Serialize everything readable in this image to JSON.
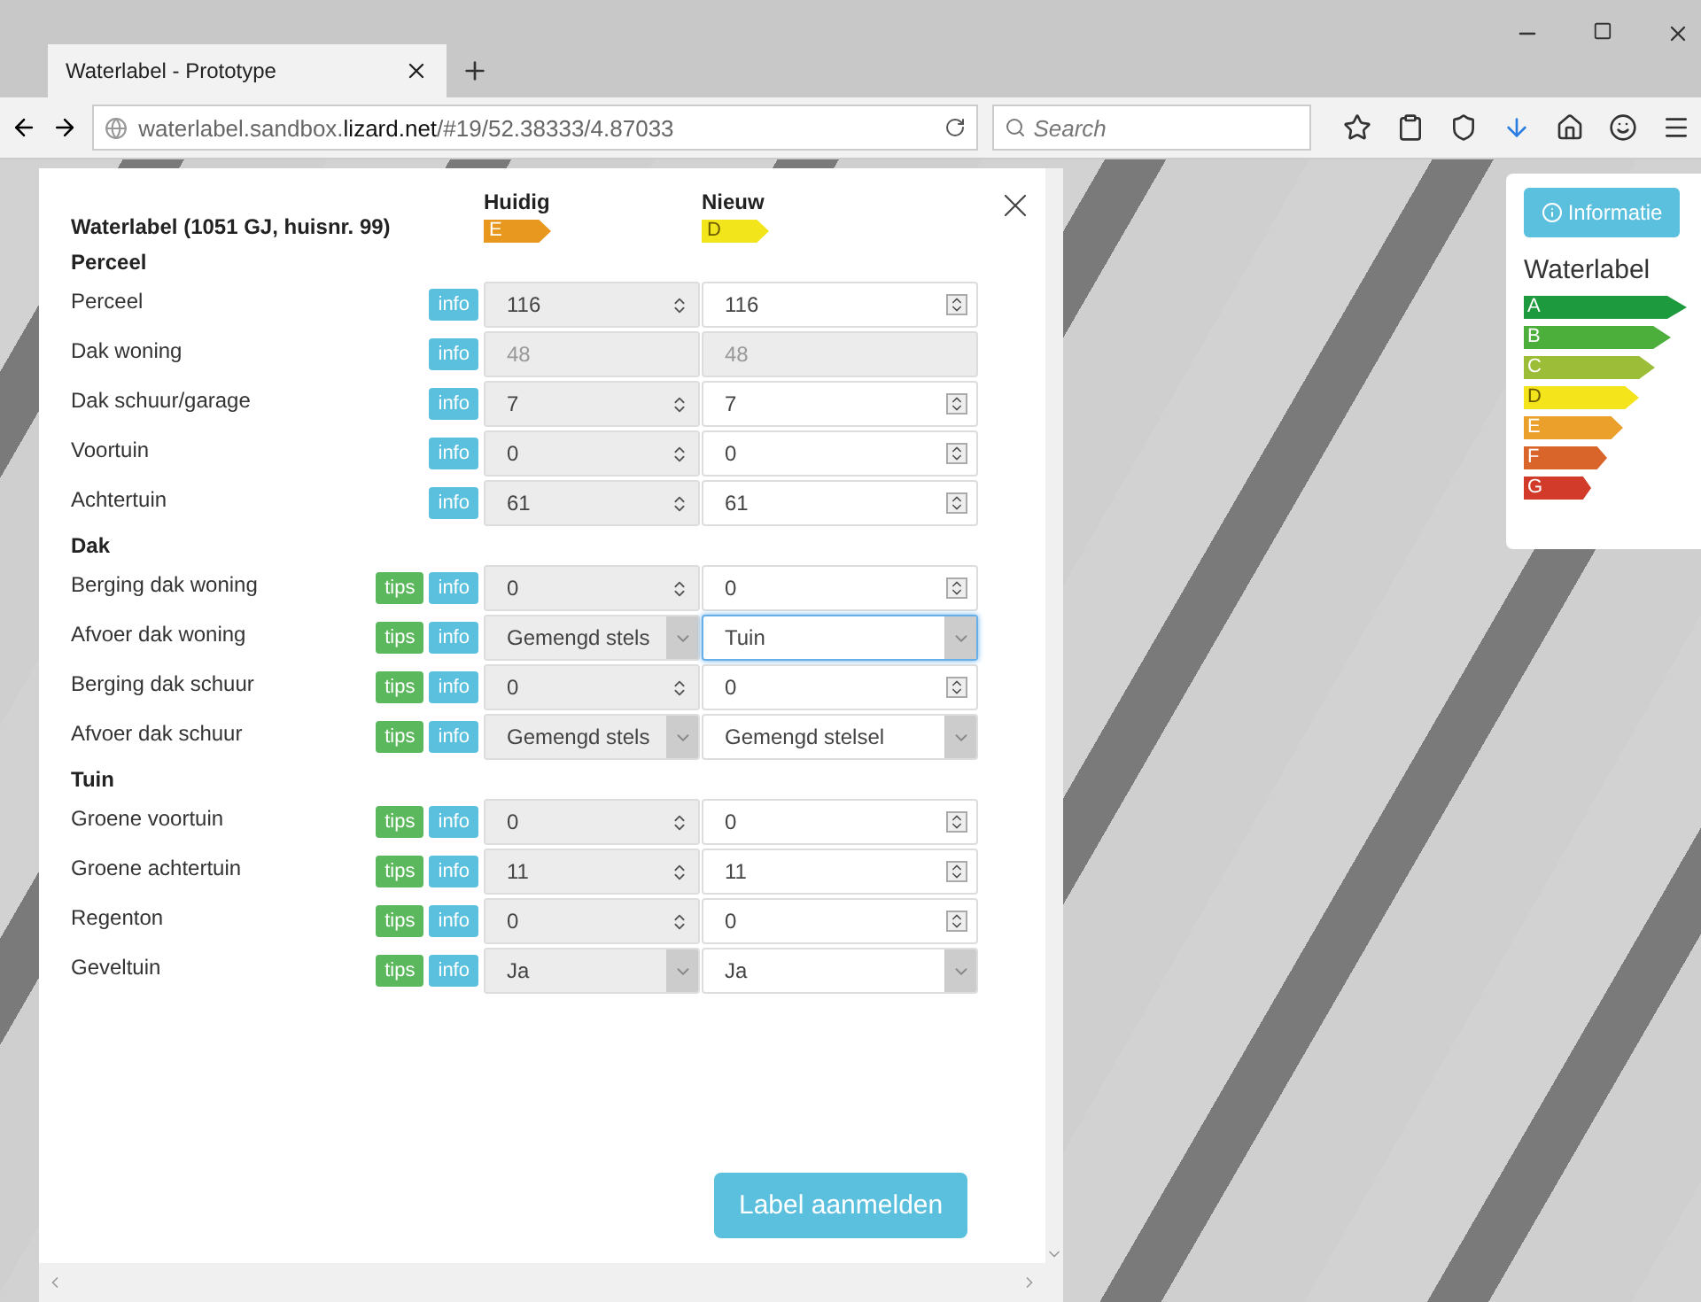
{
  "browser": {
    "tab_title": "Waterlabel - Prototype",
    "url": "waterlabel.sandbox.**lizard.net**/#19/52.38333/4.87033",
    "search_placeholder": "Search"
  },
  "form": {
    "title": "Waterlabel (1051 GJ, huisnr. 99)",
    "columns": [
      {
        "label": "Huidig",
        "badge": "E",
        "color": "#e8971f"
      },
      {
        "label": "Nieuw",
        "badge": "D",
        "color": "#f3e51b"
      }
    ],
    "sections": [
      {
        "title": "Perceel",
        "rows": [
          {
            "label": "Perceel",
            "kind": "number",
            "info": "info",
            "current": "116",
            "new": "116"
          },
          {
            "label": "Dak woning",
            "kind": "readonly",
            "info": "info",
            "current": "48",
            "new": "48"
          },
          {
            "label": "Dak schuur/garage",
            "kind": "number",
            "info": "info",
            "current": "7",
            "new": "7"
          },
          {
            "label": "Voortuin",
            "kind": "number",
            "info": "info",
            "current": "0",
            "new": "0"
          },
          {
            "label": "Achtertuin",
            "kind": "number",
            "info": "info",
            "current": "61",
            "new": "61"
          }
        ]
      },
      {
        "title": "Dak",
        "rows": [
          {
            "label": "Berging dak woning",
            "kind": "number",
            "tips": "tips",
            "info": "info",
            "current": "0",
            "new": "0"
          },
          {
            "label": "Afvoer dak woning",
            "kind": "select",
            "tips": "tips",
            "info": "info",
            "current": "Gemengd stels",
            "new": "Tuin",
            "focused": true
          },
          {
            "label": "Berging dak schuur",
            "kind": "number",
            "tips": "tips",
            "info": "info",
            "current": "0",
            "new": "0"
          },
          {
            "label": "Afvoer dak schuur",
            "kind": "select",
            "tips": "tips",
            "info": "info",
            "current": "Gemengd stels",
            "new": "Gemengd stelsel",
            "focused": false
          }
        ]
      },
      {
        "title": "Tuin",
        "rows": [
          {
            "label": "Groene voortuin",
            "kind": "number",
            "tips": "tips",
            "info": "info",
            "current": "0",
            "new": "0"
          },
          {
            "label": "Groene achtertuin",
            "kind": "number",
            "tips": "tips",
            "info": "info",
            "current": "11",
            "new": "11"
          },
          {
            "label": "Regenton",
            "kind": "number",
            "tips": "tips",
            "info": "info",
            "current": "0",
            "new": "0"
          },
          {
            "label": "Geveltuin",
            "kind": "select",
            "tips": "tips",
            "info": "info",
            "current": "Ja",
            "new": "Ja",
            "focused": false
          }
        ]
      }
    ],
    "submit": "Label aanmelden"
  },
  "legend": {
    "button": "Informatie",
    "title": "Waterlabel",
    "classes": [
      {
        "letter": "A",
        "color": "#1e9a3e"
      },
      {
        "letter": "B",
        "color": "#4cae3b"
      },
      {
        "letter": "C",
        "color": "#9bbd37"
      },
      {
        "letter": "D",
        "color": "#f4e41c"
      },
      {
        "letter": "E",
        "color": "#eaa02b"
      },
      {
        "letter": "F",
        "color": "#d9652a"
      },
      {
        "letter": "G",
        "color": "#d23a2a"
      }
    ]
  }
}
